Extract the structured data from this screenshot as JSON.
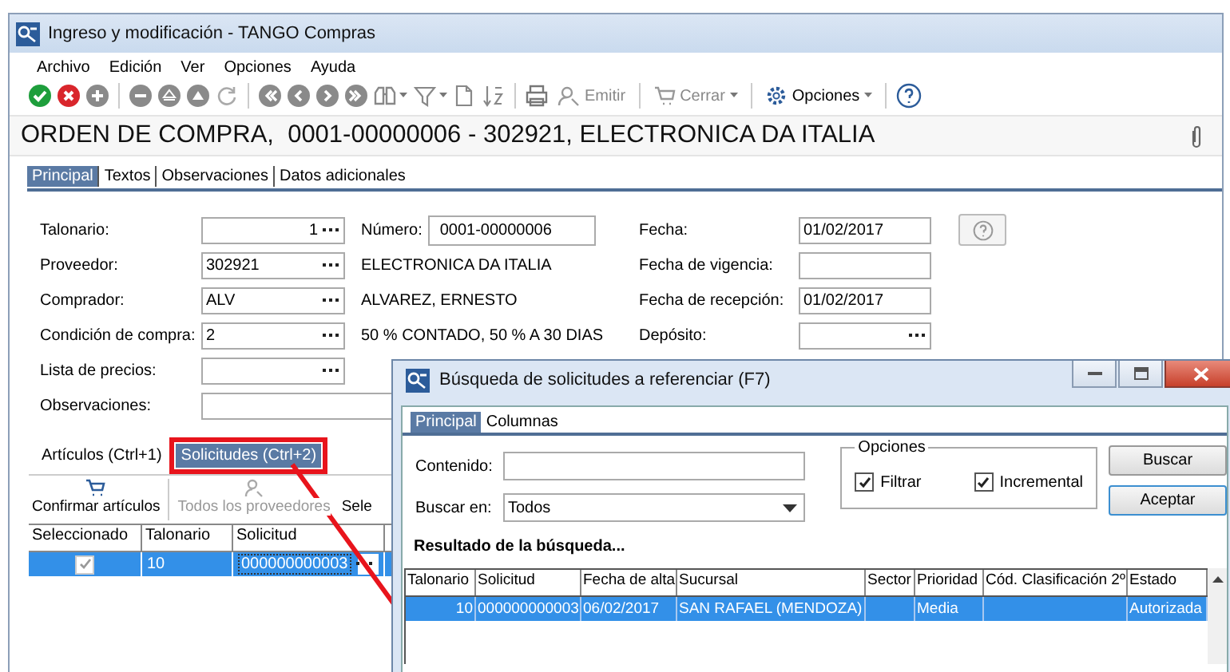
{
  "window": {
    "title": "Ingreso y modificación - TANGO Compras"
  },
  "menu": [
    "Archivo",
    "Edición",
    "Ver",
    "Opciones",
    "Ayuda"
  ],
  "toolbar_buttons": [
    {
      "label": "Emitir",
      "disabled": true,
      "dropdown": false
    },
    {
      "label": "Cerrar",
      "disabled": true,
      "dropdown": true
    },
    {
      "label": "Opciones",
      "disabled": false,
      "dropdown": true
    }
  ],
  "heading": "ORDEN DE COMPRA,  0001-00000006 - 302921, ELECTRONICA DA ITALIA",
  "tabs": [
    {
      "label": "Principal",
      "selected": true
    },
    {
      "label": "Textos",
      "selected": false
    },
    {
      "label": "Observaciones",
      "selected": false
    },
    {
      "label": "Datos adicionales",
      "selected": false
    }
  ],
  "form_left": [
    {
      "label": "Talonario:",
      "value": "1",
      "kind": "number",
      "lookup": true,
      "extra_label": "Número:",
      "extra_value": "0001-00000006"
    },
    {
      "label": "Proveedor:",
      "value": "302921",
      "kind": "text",
      "lookup": true,
      "description": "ELECTRONICA DA ITALIA"
    },
    {
      "label": "Comprador:",
      "value": "ALV",
      "kind": "text",
      "lookup": true,
      "description": "ALVAREZ, ERNESTO"
    },
    {
      "label": "Condición de compra:",
      "value": "2",
      "kind": "text",
      "lookup": true,
      "description": "50 % CONTADO, 50 % A 30 DIAS"
    },
    {
      "label": "Lista de precios:",
      "kind": "text",
      "lookup": true
    },
    {
      "label": "Observaciones:",
      "kind": "wide"
    }
  ],
  "form_right": [
    {
      "label": "Fecha:",
      "value": "01/02/2017",
      "lookup": false
    },
    {
      "label": "Fecha de vigencia:",
      "lookup": false
    },
    {
      "label": "Fecha de recepción:",
      "value": "01/02/2017",
      "lookup": false
    },
    {
      "label": "Depósito:",
      "lookup": true
    }
  ],
  "detail_tabs": [
    {
      "label": "Artículos (Ctrl+1)",
      "selected": false
    },
    {
      "label": "Solicitudes (Ctrl+2)",
      "selected": true
    }
  ],
  "detail_toolbar": [
    {
      "label": "Confirmar artículos",
      "disabled": false,
      "kind": "cart"
    },
    {
      "label": "Todos los proveedores",
      "disabled": true,
      "kind": "person"
    },
    {
      "label": "Sele",
      "disabled": false,
      "kind": "text"
    }
  ],
  "detail_table": {
    "columns": [
      "Seleccionado",
      "Talonario",
      "Solicitud"
    ],
    "rows": [
      {
        "selected": true,
        "checked": true,
        "talonario": "10",
        "solicitud": "000000000003"
      }
    ]
  },
  "dialog": {
    "title": "Búsqueda de solicitudes a referenciar (F7)",
    "tabs": [
      {
        "label": "Principal",
        "selected": true
      },
      {
        "label": "Columnas",
        "selected": false
      }
    ],
    "contenido_label": "Contenido:",
    "buscar_en": {
      "label": "Buscar en:",
      "value": "Todos"
    },
    "options": {
      "title": "Opciones",
      "items": [
        {
          "label": "Filtrar",
          "checked": true
        },
        {
          "label": "Incremental",
          "checked": true
        }
      ]
    },
    "buttons": [
      "Buscar",
      "Aceptar"
    ],
    "results_title": "Resultado de la búsqueda...",
    "table": {
      "columns": [
        "Talonario",
        "Solicitud",
        "Fecha de alta",
        "Sucursal",
        "Sector",
        "Prioridad",
        "Cód. Clasificación 2º",
        "Estado"
      ],
      "rows": [
        {
          "selected": true,
          "cells": [
            "10",
            "000000000003",
            "06/02/2017",
            "SAN RAFAEL (MENDOZA)",
            null,
            "Media",
            null,
            "Autorizada"
          ]
        }
      ]
    }
  }
}
